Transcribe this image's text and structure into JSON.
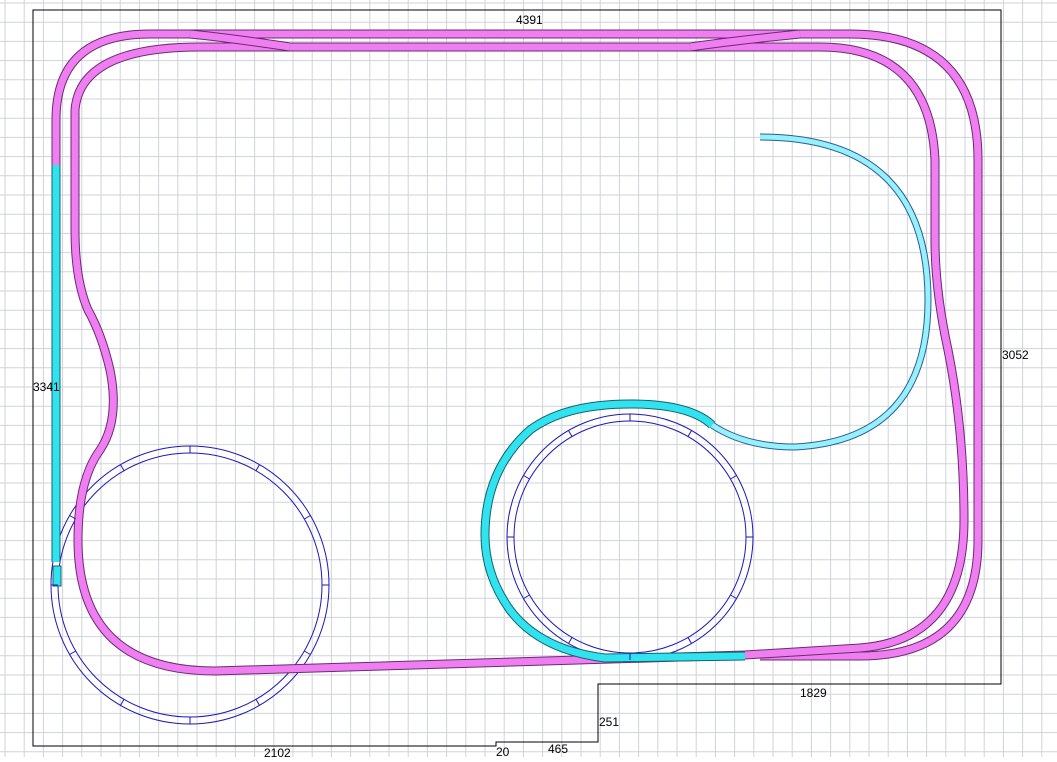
{
  "layout": {
    "dimensions": {
      "top": "4391",
      "right": "3052",
      "left": "3341",
      "bottom_left": "2102",
      "bottom_step_small": "20",
      "bottom_step_width": "465",
      "bottom_step_height": "251",
      "bottom_right": "1829"
    },
    "colors": {
      "grid": "#cfd3d8",
      "main_track": "#ef7ff0",
      "branch_track": "#31e3ef",
      "spur_track": "#97f0fa",
      "loop_track": "#1f17b8",
      "outline": "#000000"
    }
  }
}
